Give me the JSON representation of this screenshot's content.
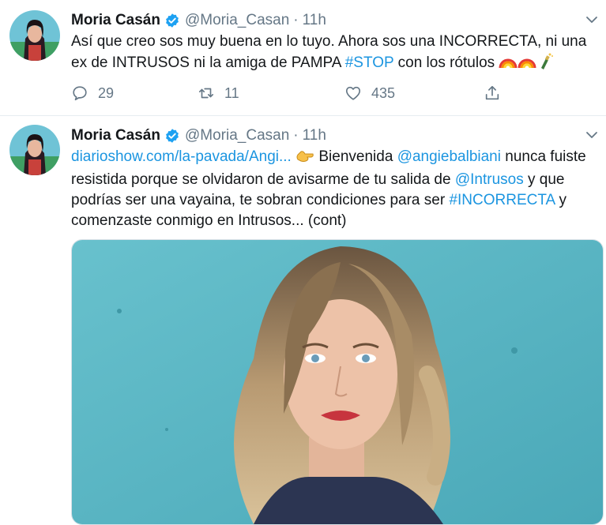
{
  "tweets": [
    {
      "author": {
        "name": "Moria Casán",
        "handle": "@Moria_Casan"
      },
      "dot": "·",
      "time": "11h",
      "text_before": "Así que creo sos muy buena en lo tuyo. Ahora sos una INCORRECTA, ni una ex de INTRUSOS ni la amiga de PAMPA ",
      "hashtag": "#STOP",
      "text_after": " con los rótulos",
      "emojis": [
        "rainbow-icon",
        "rainbow-icon",
        "champagne-icon"
      ],
      "stats": {
        "replies": "29",
        "retweets": "11",
        "likes": "435"
      }
    },
    {
      "author": {
        "name": "Moria Casán",
        "handle": "@Moria_Casan"
      },
      "dot": "·",
      "time": "11h",
      "link": "diarioshow.com/la-pavada/Angi...",
      "text_1": " Bienvenida ",
      "mention_1": "@angiebalbiani",
      "text_2": " nunca fuiste resistida porque se olvidaron de avisarme de tu salida de ",
      "mention_2": "@Intrusos",
      "text_3": " y que podrías ser una vayaina, te sobran condiciones para ser ",
      "hashtag": "#INCORRECTA",
      "text_4": " y comenzaste conmigo en Intrusos... (cont)",
      "emoji": "pointing-hand-icon"
    }
  ],
  "colors": {
    "link": "#1b95e0",
    "secondary": "#657786",
    "verified": "#1da1f2",
    "media_bg": "#5ab7c5"
  }
}
